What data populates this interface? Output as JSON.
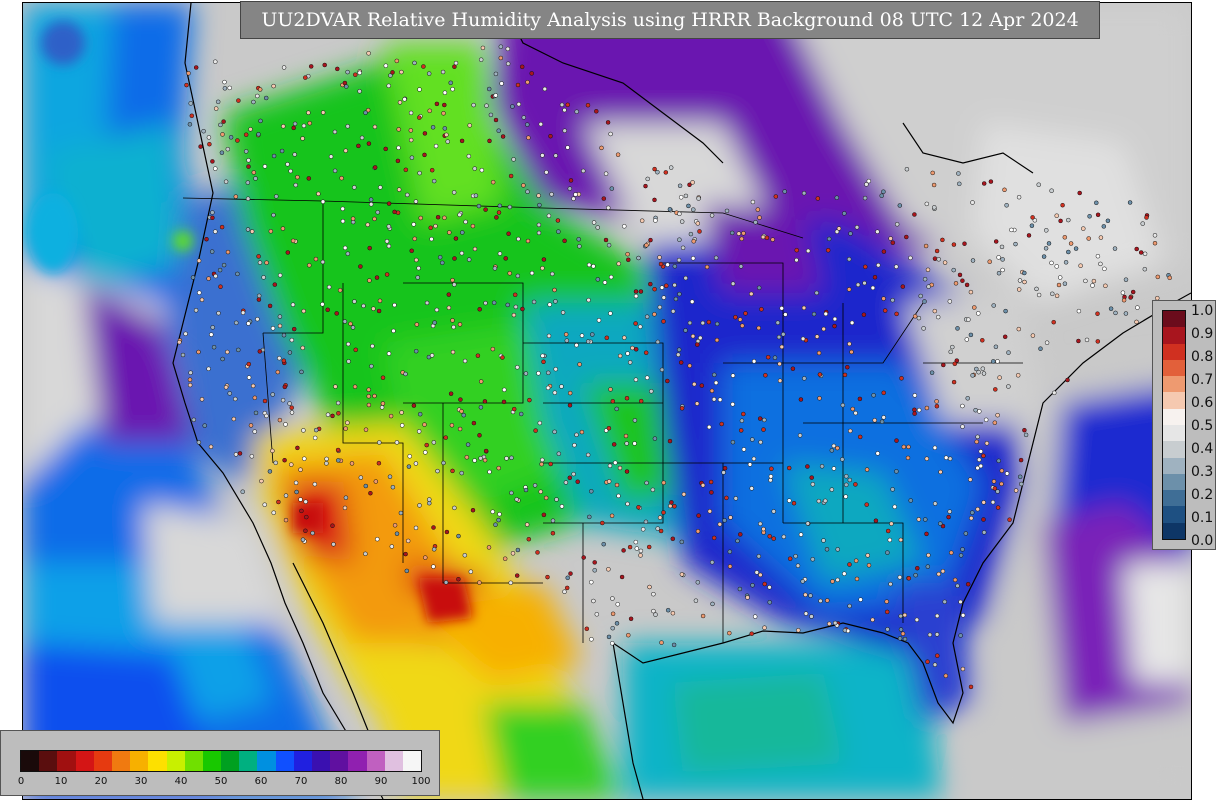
{
  "title": "UU2DVAR Relative Humidity Analysis using HRRR Background 08 UTC 12 Apr 2024",
  "analysis_legend": {
    "ticks": [
      "0",
      "10",
      "20",
      "30",
      "40",
      "50",
      "60",
      "70",
      "80",
      "90",
      "100"
    ],
    "colors": [
      "#1a0a0a",
      "#5a0e0e",
      "#a01010",
      "#d41515",
      "#e63a10",
      "#f07a10",
      "#f7b000",
      "#fde000",
      "#c8f000",
      "#70e000",
      "#18c800",
      "#00a020",
      "#00b080",
      "#0090e0",
      "#1050ff",
      "#2020e0",
      "#3a10b0",
      "#6010a0",
      "#9020b0",
      "#c060c0",
      "#e0c0e0",
      "#f6f6f6"
    ]
  },
  "obs_legend": {
    "ticks": [
      "1.0",
      "0.9",
      "0.8",
      "0.7",
      "0.6",
      "0.5",
      "0.4",
      "0.3",
      "0.2",
      "0.1",
      "0.0"
    ],
    "colors": [
      "#6b0c1c",
      "#a8151e",
      "#d03020",
      "#e2603a",
      "#ee9a70",
      "#f5c9b0",
      "#f7f2ef",
      "#e6e6e6",
      "#c8cdd0",
      "#9fb2c0",
      "#6c90aa",
      "#3f6e96",
      "#1e5082",
      "#0e3666"
    ]
  },
  "map_colors": {
    "land_low": "#c9c9c9",
    "ocean_blue": "#0a55e8",
    "ocean_cyan": "#10a6e0",
    "purple": "#6a18b0",
    "violet": "#8a2ab8",
    "green": "#1bc41b",
    "bright_green": "#60e020",
    "yellow": "#f0e020",
    "orange": "#f39a10",
    "red": "#d81818",
    "teal": "#16b0a0",
    "navy": "#1c20c8"
  }
}
